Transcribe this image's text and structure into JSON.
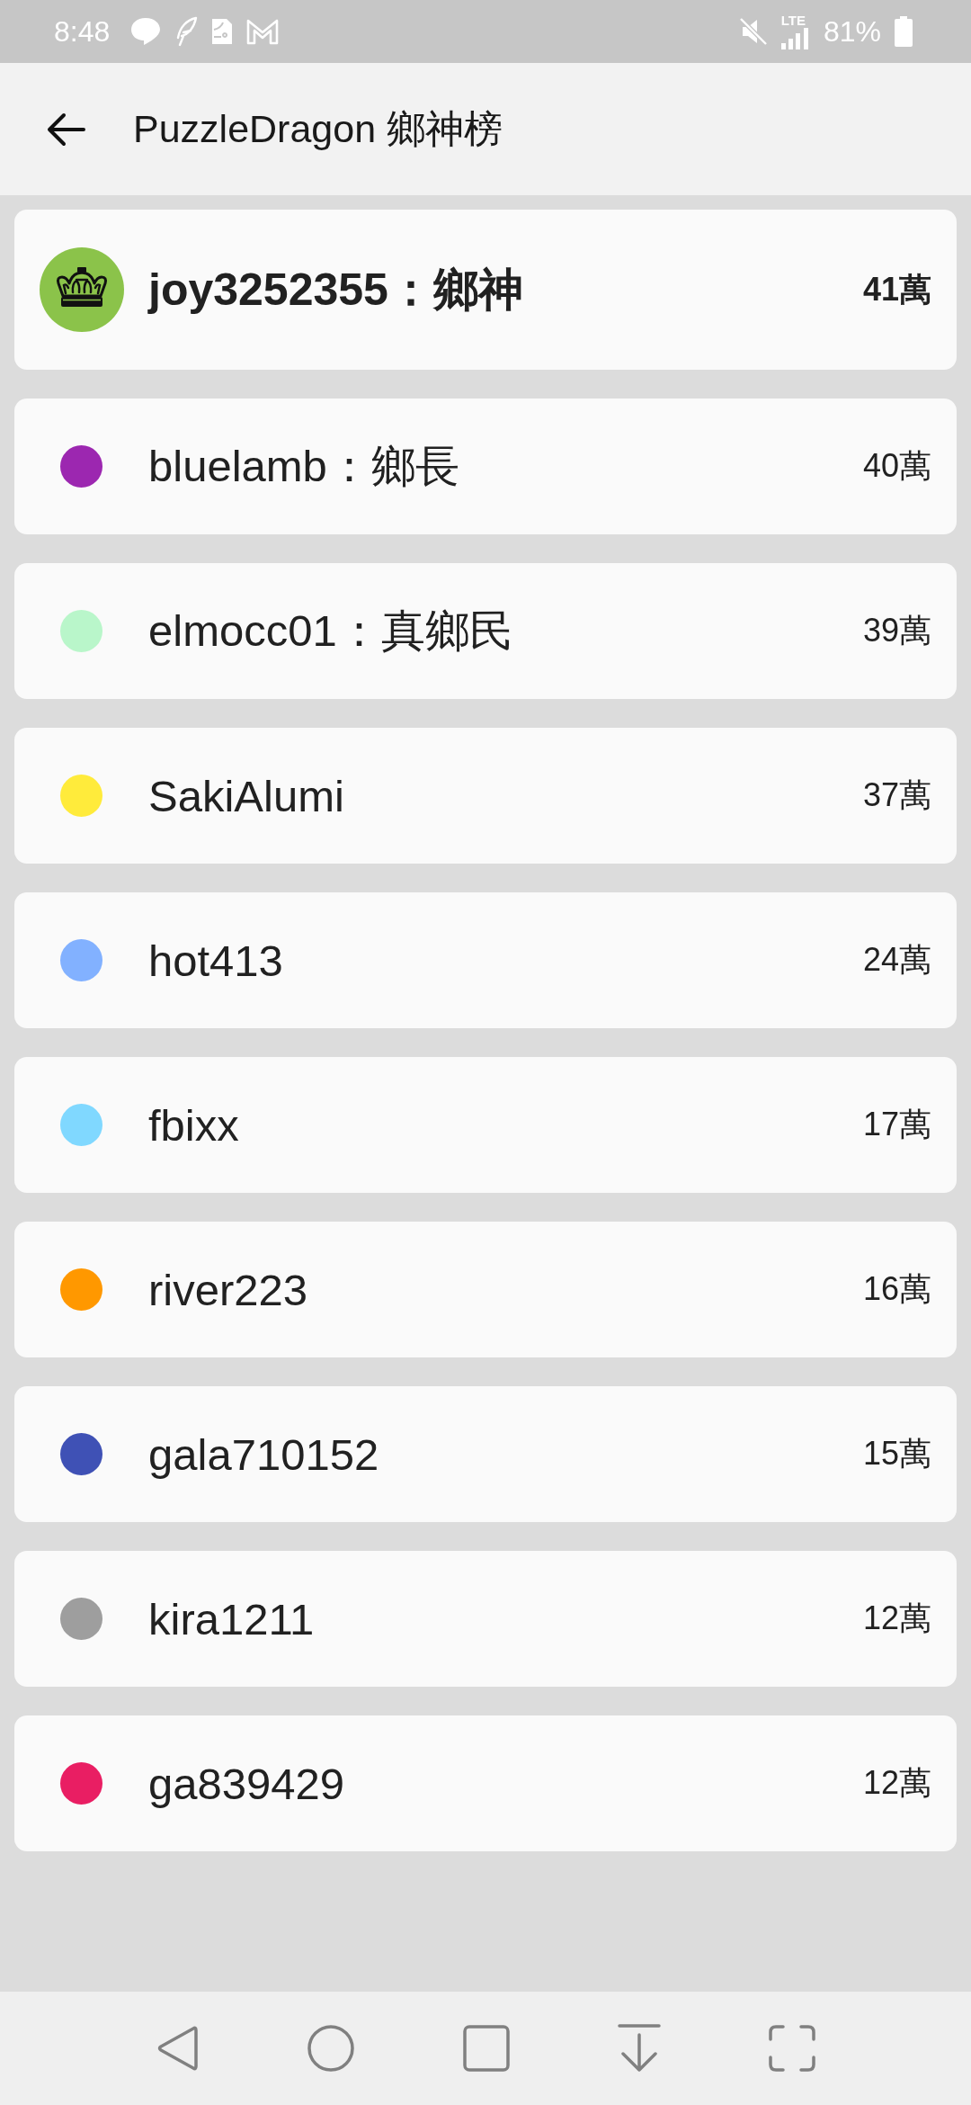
{
  "status_bar": {
    "time": "8:48",
    "network": "LTE",
    "battery": "81%"
  },
  "app_bar": {
    "title": "PuzzleDragon 鄉神榜"
  },
  "ranking": [
    {
      "kind": "crown",
      "name": "joy3252355：鄉神",
      "score": "41萬",
      "color": "#8bc34a"
    },
    {
      "kind": "dot",
      "name": "bluelamb：鄉長",
      "score": "40萬",
      "color": "#9c27b0"
    },
    {
      "kind": "dot",
      "name": "elmocc01：真鄉民",
      "score": "39萬",
      "color": "#b9f6ca"
    },
    {
      "kind": "dot",
      "name": "SakiAlumi",
      "score": "37萬",
      "color": "#ffeb3b"
    },
    {
      "kind": "dot",
      "name": "hot413",
      "score": "24萬",
      "color": "#82b1ff"
    },
    {
      "kind": "dot",
      "name": "fbixx",
      "score": "17萬",
      "color": "#80d8ff"
    },
    {
      "kind": "dot",
      "name": "river223",
      "score": "16萬",
      "color": "#ff9800"
    },
    {
      "kind": "dot",
      "name": "gala710152",
      "score": "15萬",
      "color": "#3f51b5"
    },
    {
      "kind": "dot",
      "name": "kira1211",
      "score": "12萬",
      "color": "#9e9e9e"
    },
    {
      "kind": "dot",
      "name": "ga839429",
      "score": "12萬",
      "color": "#e91e63"
    }
  ]
}
